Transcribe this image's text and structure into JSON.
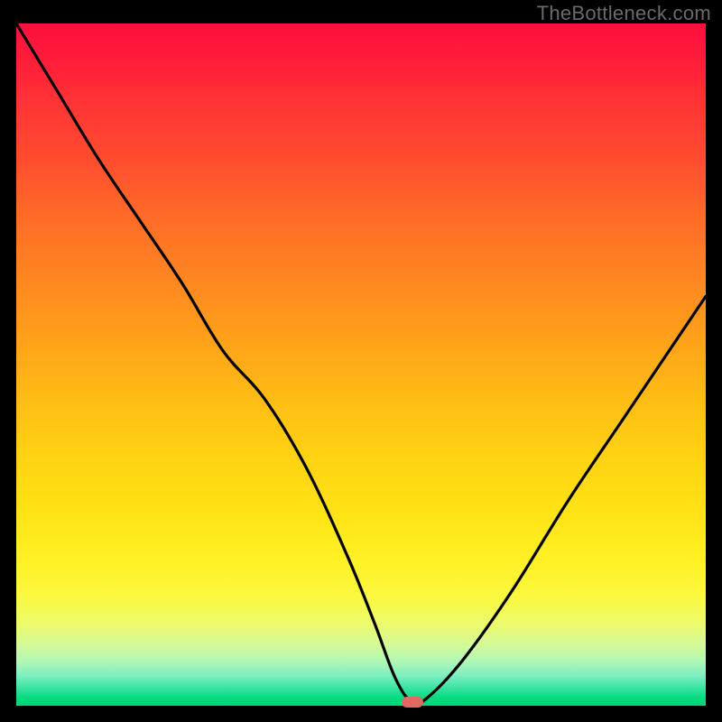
{
  "watermark": "TheBottleneck.com",
  "chart_data": {
    "type": "line",
    "title": "",
    "xlabel": "",
    "ylabel": "",
    "xlim": [
      0,
      100
    ],
    "ylim": [
      0,
      100
    ],
    "grid": false,
    "legend": false,
    "series": [
      {
        "name": "bottleneck-curve",
        "x": [
          0,
          6,
          12,
          18,
          24,
          30,
          36,
          42,
          48,
          52,
          55,
          57.5,
          60,
          65,
          72,
          80,
          88,
          96,
          100
        ],
        "y": [
          100,
          90,
          80,
          71,
          62,
          52,
          45,
          35,
          22,
          12,
          4,
          0.5,
          1.5,
          7,
          17,
          30,
          42,
          54,
          60
        ]
      }
    ],
    "marker": {
      "x": 57.5,
      "y": 0.5,
      "color": "#e06a63"
    },
    "background_gradient": {
      "top": "#ff0f3d",
      "mid": "#ffdf14",
      "bottom": "#00d676"
    },
    "axes_visible": false
  }
}
